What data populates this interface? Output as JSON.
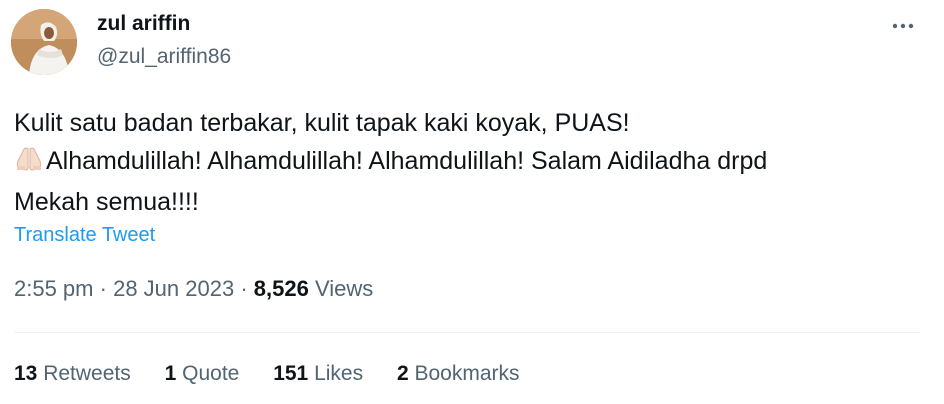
{
  "author": {
    "name": "zul ariffin",
    "handle": "@zul_ariffin86",
    "avatar_icon": "profile-photo"
  },
  "more_icon": "more-horizontal-icon",
  "tweet": {
    "line1": "Kulit satu badan terbakar, kulit tapak kaki koyak, PUAS!",
    "emoji": "praying-hands-emoji",
    "line2": "Alhamdulillah! Alhamdulillah! Alhamdulillah! Salam Aidiladha drpd",
    "line3": "Mekah semua!!!!"
  },
  "translate_label": "Translate Tweet",
  "meta": {
    "time": "2:55 pm",
    "separator": "·",
    "date": "28 Jun 2023",
    "views_count": "8,526",
    "views_label": "Views"
  },
  "stats": {
    "retweets_count": "13",
    "retweets_label": "Retweets",
    "quotes_count": "1",
    "quotes_label": "Quote",
    "likes_count": "151",
    "likes_label": "Likes",
    "bookmarks_count": "2",
    "bookmarks_label": "Bookmarks"
  },
  "colors": {
    "text": "#0f1419",
    "secondary": "#536471",
    "link": "#1d9bf0",
    "divider": "#eff3f4"
  }
}
